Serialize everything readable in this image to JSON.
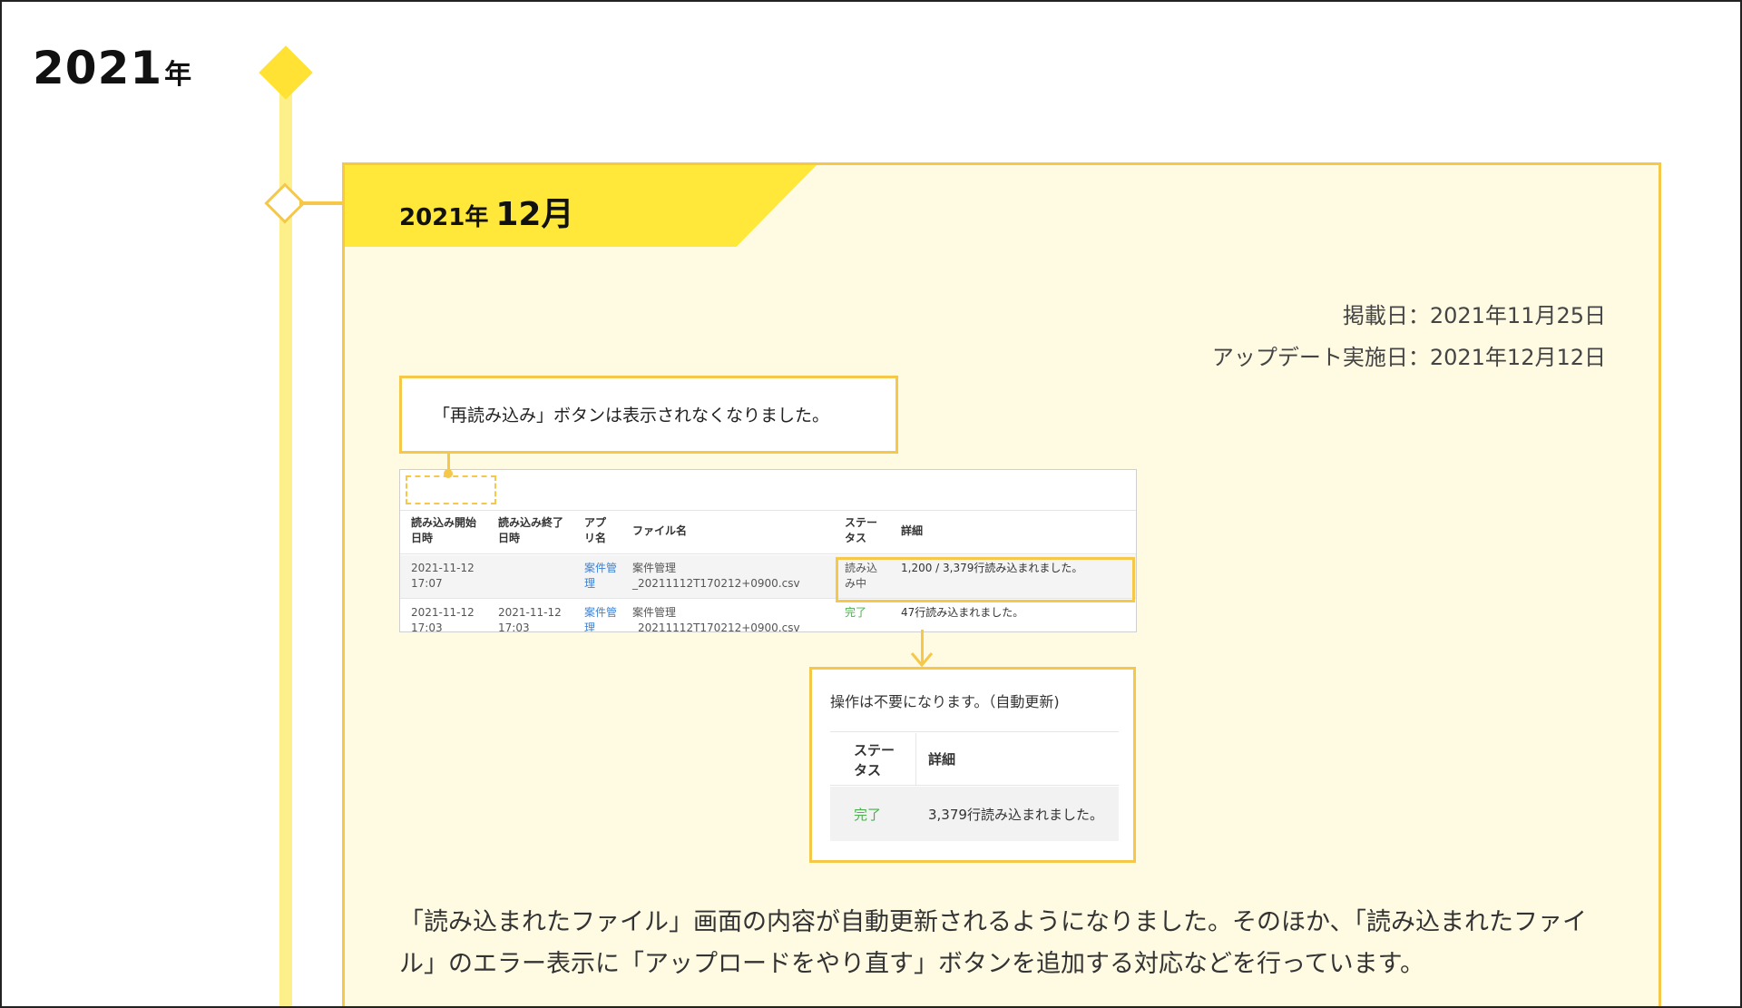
{
  "year_heading": {
    "number": "2021",
    "unit": "年"
  },
  "card": {
    "title_year": "2021年",
    "title_month": "12月",
    "posted_date": "掲載日：2021年11月25日",
    "update_date": "アップデート実施日：2021年12月12日",
    "callout_top": "「再読み込み」ボタンは表示されなくなりました。",
    "screenshot": {
      "headers": [
        "読み込み開始\n日時",
        "読み込み終了\n日時",
        "アプ\nリ名",
        "ファイル名",
        "ステー\nタス",
        "詳細"
      ],
      "rows": [
        [
          "2021-11-12\n17:07",
          "",
          "案件管\n理",
          "案件管理\n_20211112T170212+0900.csv",
          "読み込\nみ中",
          "1,200 / 3,379行読み込まれました。"
        ],
        [
          "2021-11-12\n17:03",
          "2021-11-12\n17:03",
          "案件管\n理",
          "案件管理\n_20211112T170212+0900.csv",
          "完了",
          "47行読み込まれました。"
        ]
      ]
    },
    "callout_bottom": {
      "message": "操作は不要になります。（自動更新)",
      "headers": [
        "ステー\nタス",
        "詳細"
      ],
      "row": [
        "完了",
        "3,379行読み込まれました。"
      ]
    },
    "body_text": "「読み込まれたファイル」画面の内容が自動更新されるようになりました。そのほか、「読み込まれたファイル」のエラー表示に「アップロードをやり直す」ボタンを追加する対応などを行っています。"
  },
  "colors": {
    "accent": "#ffe83a",
    "border": "#f5c84a",
    "card_bg": "#fffbe3",
    "timeline": "#fdf08a"
  }
}
